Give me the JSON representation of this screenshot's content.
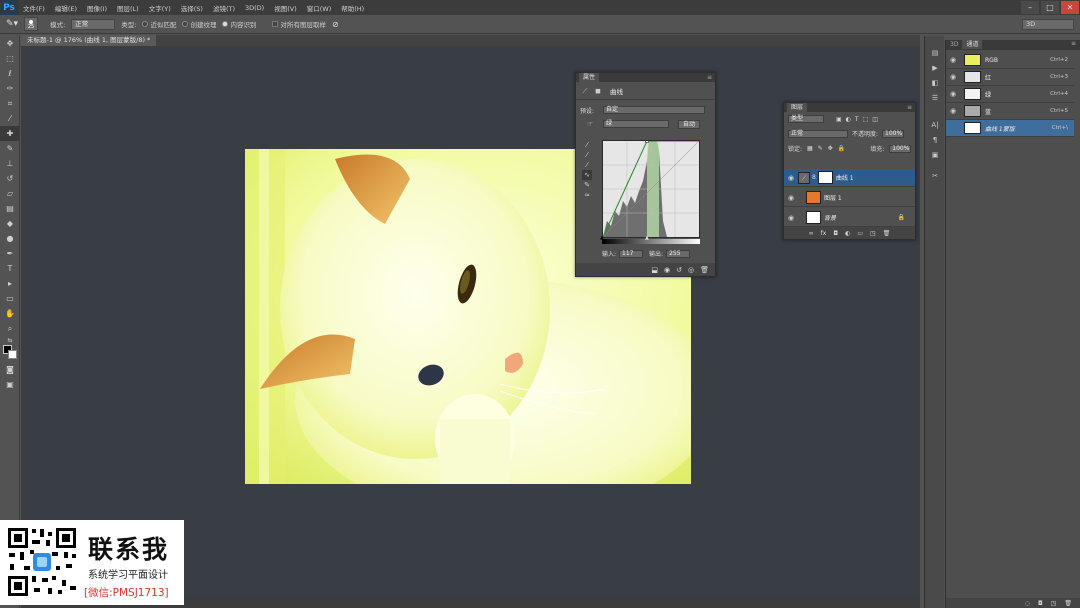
{
  "menubar": {
    "logo": "Ps",
    "items": [
      "文件(F)",
      "编辑(E)",
      "图像(I)",
      "图层(L)",
      "文字(Y)",
      "选择(S)",
      "滤镜(T)",
      "3D(D)",
      "视图(V)",
      "窗口(W)",
      "帮助(H)"
    ]
  },
  "options": {
    "brush_size": "25",
    "mode_label": "模式:",
    "mode_value": "正常",
    "type_label": "类型:",
    "radio_1": "近似匹配",
    "radio_2": "创建纹理",
    "radio_3": "内容识别",
    "check_all_layers": "对所有图层取样",
    "workspace": "3D"
  },
  "document": {
    "tab_title": "未标题-1 @ 176% (曲线 1, 图层蒙版/8) *"
  },
  "properties": {
    "tab": "属性",
    "title": "曲线",
    "preset_label": "预设:",
    "preset_value": "自定",
    "channel_value": "绿",
    "auto_button": "自动",
    "input_label": "输入:",
    "input_value": "117",
    "output_label": "输出:",
    "output_value": "255"
  },
  "layers_panel": {
    "tab": "图层",
    "filter_kind": "类型",
    "blend_mode": "正常",
    "opacity_label": "不透明度:",
    "opacity_value": "100%",
    "lock_label": "锁定:",
    "fill_label": "填充:",
    "fill_value": "100%",
    "layers": [
      {
        "name": "曲线 1"
      },
      {
        "name": "图层 1"
      },
      {
        "name": "背景"
      }
    ]
  },
  "channels_panel": {
    "tabs": [
      "3D",
      "通道"
    ],
    "channels": [
      {
        "name": "RGB",
        "shortcut": "Ctrl+2"
      },
      {
        "name": "红",
        "shortcut": "Ctrl+3"
      },
      {
        "name": "绿",
        "shortcut": "Ctrl+4"
      },
      {
        "name": "蓝",
        "shortcut": "Ctrl+5"
      },
      {
        "name": "曲线 1蒙版",
        "shortcut": "Ctrl+\\"
      }
    ]
  },
  "watermark": {
    "title": "联系我",
    "subtitle": "系统学习平面设计",
    "wechat": "[微信:PMSJ1713]"
  },
  "colors": {
    "selected_layer": "#2d5b8c",
    "canvas_bg": "#393d44",
    "accent_red": "#d9342b"
  }
}
